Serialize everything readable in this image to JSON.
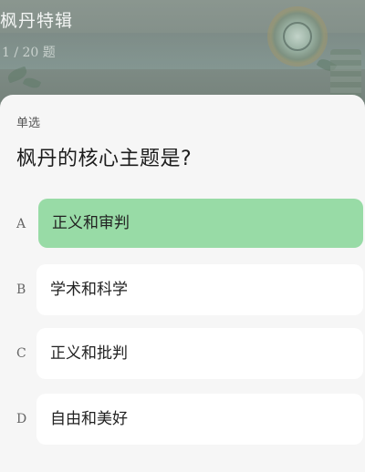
{
  "header": {
    "title": "枫丹特辑",
    "progress": "1 / 20 题"
  },
  "question": {
    "type_label": "单选",
    "text": "枫丹的核心主题是?",
    "options": [
      {
        "letter": "A",
        "label": "正义和审判",
        "selected": true
      },
      {
        "letter": "B",
        "label": "学术和科学",
        "selected": false
      },
      {
        "letter": "C",
        "label": "正义和批判",
        "selected": false
      },
      {
        "letter": "D",
        "label": "自由和美好",
        "selected": false
      }
    ]
  },
  "colors": {
    "selected_option": "#98dba6",
    "option_background": "#ffffff",
    "sheet_background": "#f6f6f6",
    "header_overlay": "#7d8a83"
  }
}
